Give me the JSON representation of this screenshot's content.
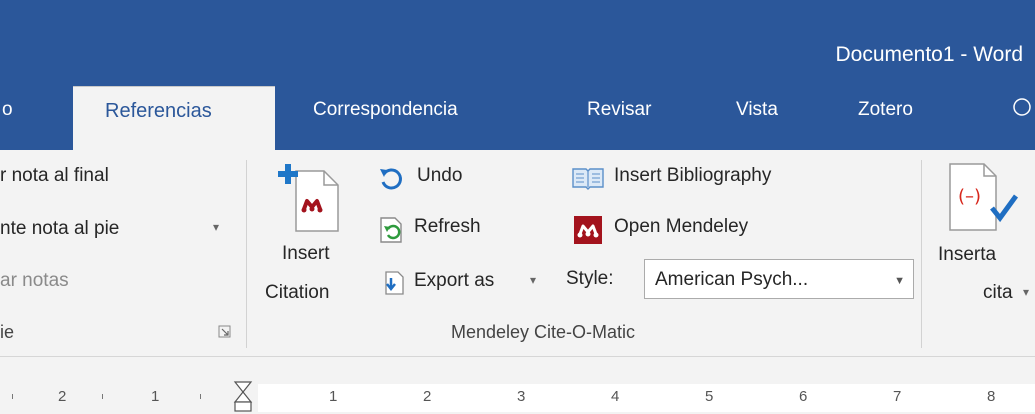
{
  "window": {
    "title": "Documento1 - Word"
  },
  "tabs": [
    {
      "label": "o"
    },
    {
      "label": "Referencias",
      "active": true
    },
    {
      "label": "Correspondencia"
    },
    {
      "label": "Revisar"
    },
    {
      "label": "Vista"
    },
    {
      "label": "Zotero"
    }
  ],
  "footnotes_group": {
    "insert_endnote": "r nota al final",
    "next_footnote": "nte nota al pie",
    "show_notes": "ar notas",
    "group_label": "ie"
  },
  "mendeley_group": {
    "insert_citation_line1": "Insert",
    "insert_citation_line2": "Citation",
    "undo": "Undo",
    "refresh": "Refresh",
    "export_as": "Export as",
    "insert_bibliography": "Insert Bibliography",
    "open_mendeley": "Open Mendeley",
    "style_label": "Style:",
    "style_value": "American Psych...",
    "group_label": "Mendeley Cite-O-Matic"
  },
  "citations_group": {
    "insert_cite_line1": "Inserta",
    "insert_cite_line2": "cita"
  },
  "ruler": {
    "left_numbers": [
      "2",
      "1"
    ],
    "right_numbers": [
      "1",
      "2",
      "3",
      "4",
      "5",
      "6",
      "7",
      "8"
    ]
  },
  "colors": {
    "accent": "#2b579a",
    "ribbon_bg": "#f3f3f3",
    "mendeley_red": "#a3131d"
  }
}
